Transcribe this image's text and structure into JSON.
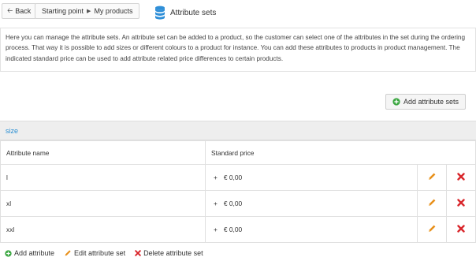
{
  "topbar": {
    "back_label": "Back",
    "breadcrumb": [
      "Starting point",
      "My products"
    ],
    "title": "Attribute sets"
  },
  "intro_text": "Here you can manage the attribute sets. An attribute set can be added to a product, so the customer can select one of the attributes in the set during the ordering process. That way it is possible to add sizes or different colours to a product for instance. You can add these attributes to products in product management. The indicated standard price can be used to add attribute related price differences to certain products.",
  "add_set_label": "Add attribute sets",
  "set": {
    "name": "size",
    "columns": [
      "Attribute name",
      "Standard price"
    ],
    "rows": [
      {
        "name": "l",
        "sign": "+",
        "price": "€ 0,00"
      },
      {
        "name": "xl",
        "sign": "+",
        "price": "€ 0,00"
      },
      {
        "name": "xxl",
        "sign": "+",
        "price": "€ 0,00"
      }
    ]
  },
  "footer": {
    "add_attribute": "Add attribute",
    "edit_set": "Edit attribute set",
    "delete_set": "Delete attribute set"
  },
  "colors": {
    "link": "#2a8fd3",
    "add_green": "#3aa640",
    "edit_orange": "#e8901a",
    "delete_red": "#d9262b",
    "db_icon_blue": "#2f8fd8"
  }
}
